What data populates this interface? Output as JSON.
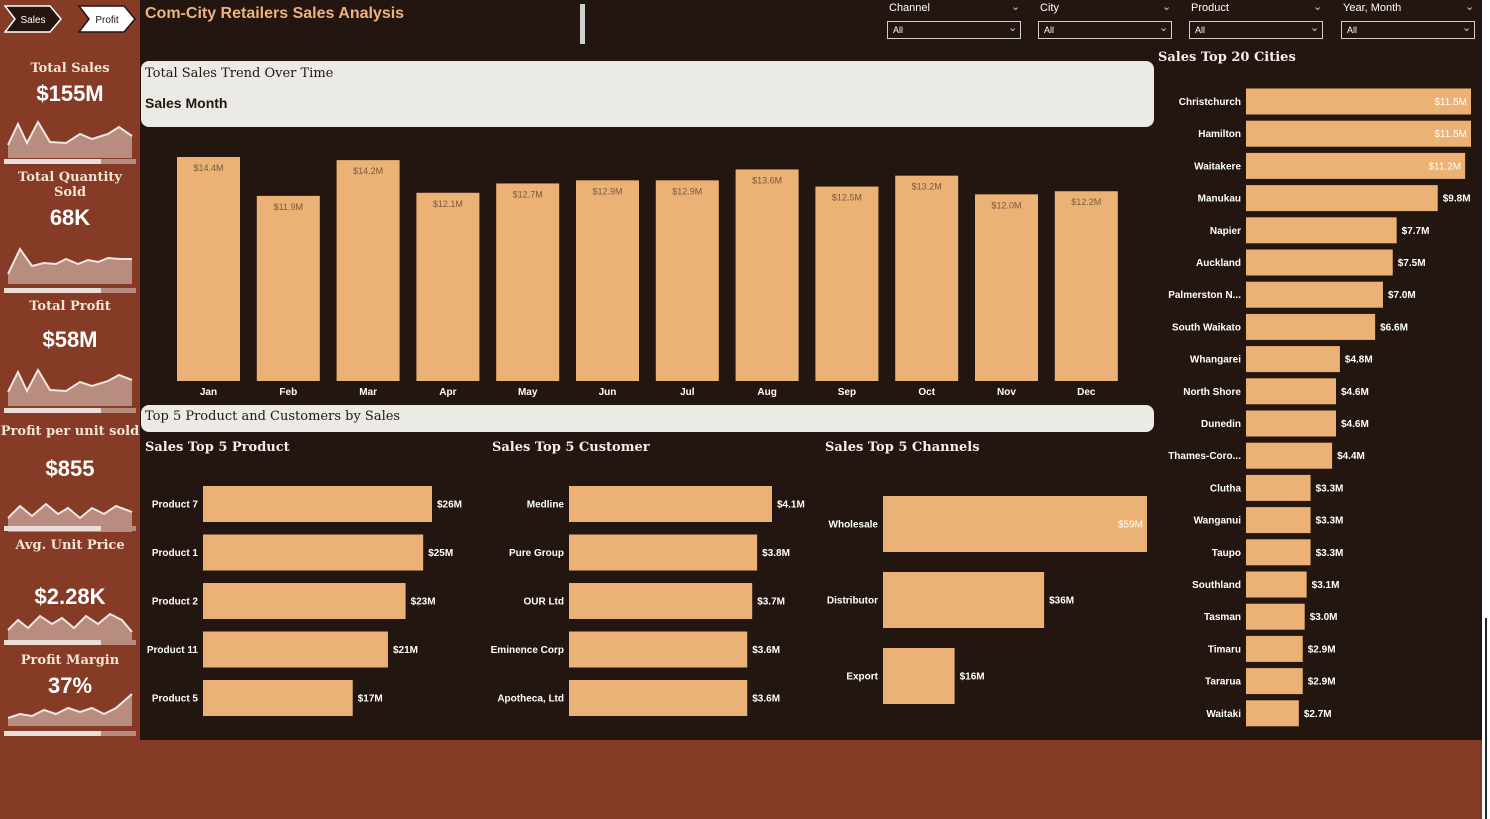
{
  "app": {
    "title": "Com-City Retailers Sales Analysis"
  },
  "nav": [
    {
      "label": "Sales",
      "bg": "#231610",
      "fg": "#ffffff",
      "stroke": "#ffffff"
    },
    {
      "label": "Profit",
      "bg": "#ffffff",
      "fg": "#231610",
      "stroke": "#231610"
    }
  ],
  "filters": [
    {
      "label": "Channel",
      "value": "All"
    },
    {
      "label": "City",
      "value": "All"
    },
    {
      "label": "Product",
      "value": "All"
    },
    {
      "label": "Year, Month",
      "value": "All"
    }
  ],
  "kpis": [
    {
      "title": "Total Sales",
      "value": "$155M"
    },
    {
      "title": "Total Quantity Sold",
      "value": "68K"
    },
    {
      "title": "Total Profit",
      "value": "$58M"
    },
    {
      "title": "Profit per unit sold",
      "value": "$855"
    },
    {
      "title": "Avg. Unit Price",
      "value": "$2.28K"
    },
    {
      "title": "Profit Margin",
      "value": "37%"
    }
  ],
  "colors": {
    "bar": "#ebb175",
    "background": "#231610",
    "sidebar": "#853b25",
    "panel": "#eceae4",
    "accent_title": "#f0b27a"
  },
  "panels": {
    "trend": {
      "title": "Total Sales Trend Over Time",
      "subtitle": "Sales Month"
    },
    "top5": {
      "title": "Top 5 Product and Customers by Sales"
    }
  },
  "chart_data": [
    {
      "id": "sales_by_month",
      "type": "bar",
      "categories": [
        "Jan",
        "Feb",
        "Mar",
        "Apr",
        "May",
        "Jun",
        "Jul",
        "Aug",
        "Sep",
        "Oct",
        "Nov",
        "Dec"
      ],
      "values": [
        14.4,
        11.9,
        14.2,
        12.1,
        12.7,
        12.9,
        12.9,
        13.6,
        12.5,
        13.2,
        12.0,
        12.2
      ],
      "labels": [
        "$14.4M",
        "$11.9M",
        "$14.2M",
        "$12.1M",
        "$12.7M",
        "$12.9M",
        "$12.9M",
        "$13.6M",
        "$12.5M",
        "$13.2M",
        "$12.0M",
        "$12.2M"
      ],
      "unit": "$M",
      "ylim": [
        0,
        14.4
      ]
    },
    {
      "id": "top_products",
      "type": "bar",
      "orientation": "horizontal",
      "title": "Sales Top 5 Product",
      "categories": [
        "Product 7",
        "Product 1",
        "Product 2",
        "Product 11",
        "Product 5"
      ],
      "values": [
        26,
        25,
        23,
        21,
        17
      ],
      "labels": [
        "$26M",
        "$25M",
        "$23M",
        "$21M",
        "$17M"
      ],
      "unit": "$M"
    },
    {
      "id": "top_customers",
      "type": "bar",
      "orientation": "horizontal",
      "title": "Sales Top 5 Customer",
      "categories": [
        "Medline",
        "Pure Group",
        "OUR Ltd",
        "Eminence Corp",
        "Apotheca, Ltd"
      ],
      "values": [
        4.1,
        3.8,
        3.7,
        3.6,
        3.6
      ],
      "labels": [
        "$4.1M",
        "$3.8M",
        "$3.7M",
        "$3.6M",
        "$3.6M"
      ],
      "unit": "$M"
    },
    {
      "id": "top_channels",
      "type": "bar",
      "orientation": "horizontal",
      "title": "Sales Top 5 Channels",
      "categories": [
        "Wholesale",
        "Distributor",
        "Export"
      ],
      "values": [
        59,
        36,
        16
      ],
      "labels": [
        "$59M",
        "$36M",
        "$16M"
      ],
      "unit": "$M"
    },
    {
      "id": "top_cities",
      "type": "bar",
      "orientation": "horizontal",
      "title": "Sales Top 20 Cities",
      "categories": [
        "Christchurch",
        "Hamilton",
        "Waitakere",
        "Manukau",
        "Napier",
        "Auckland",
        "Palmerston N...",
        "South Waikato",
        "Whangarei",
        "North Shore",
        "Dunedin",
        "Thames-Coro...",
        "Clutha",
        "Wanganui",
        "Taupo",
        "Southland",
        "Tasman",
        "Timaru",
        "Tararua",
        "Waitaki"
      ],
      "values": [
        11.5,
        11.5,
        11.2,
        9.8,
        7.7,
        7.5,
        7.0,
        6.6,
        4.8,
        4.6,
        4.6,
        4.4,
        3.3,
        3.3,
        3.3,
        3.1,
        3.0,
        2.9,
        2.9,
        2.7
      ],
      "labels": [
        "$11.5M",
        "$11.5M",
        "$11.2M",
        "$9.8M",
        "$7.7M",
        "$7.5M",
        "$7.0M",
        "$6.6M",
        "$4.8M",
        "$4.6M",
        "$4.6M",
        "$4.4M",
        "$3.3M",
        "$3.3M",
        "$3.3M",
        "$3.1M",
        "$3.0M",
        "$2.9M",
        "$2.9M",
        "$2.7M"
      ],
      "unit": "$M"
    }
  ]
}
